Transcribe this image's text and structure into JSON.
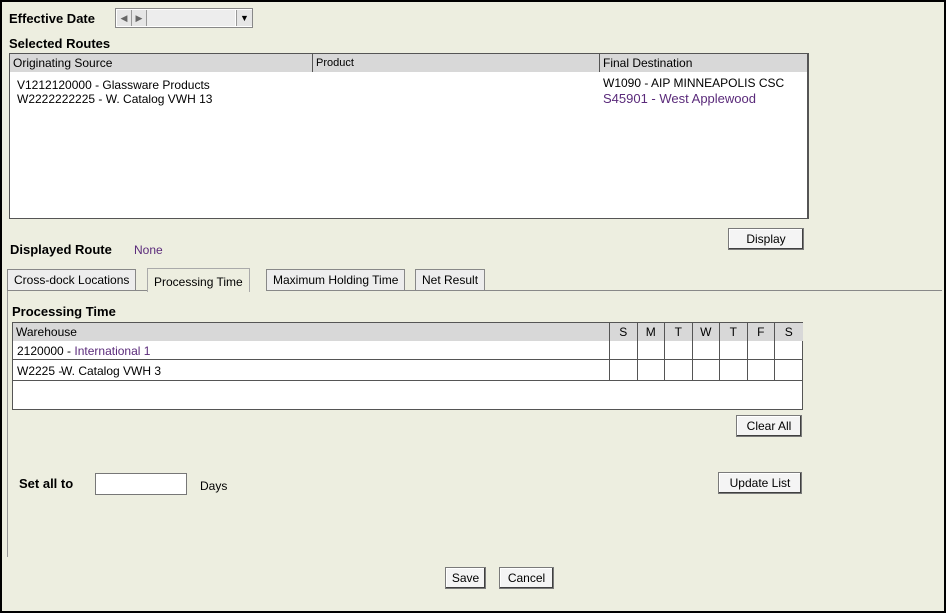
{
  "effective_date": {
    "label": "Effective Date",
    "value": ""
  },
  "selected_routes": {
    "title": "Selected Routes",
    "columns": {
      "originating_source": "Originating Source",
      "product": "Product",
      "final_destination": "Final Destination"
    },
    "rows": [
      {
        "source": "V1212120000 - Glassware Products",
        "destination_code": "W1090 - ",
        "destination_name": "AIP MINNEAPOLIS CSC"
      },
      {
        "source": "W2222222225 - W. Catalog VWH 13",
        "destination_code": "S45901 - ",
        "destination_name": "West Applewood"
      }
    ]
  },
  "displayed_route": {
    "label": "Displayed Route",
    "value": "None"
  },
  "display_button": "Display",
  "tabs": [
    {
      "label": "Cross-dock Locations",
      "active": false
    },
    {
      "label": "Processing Time",
      "active": true
    },
    {
      "label": "Maximum Holding Time",
      "active": false
    },
    {
      "label": "Net Result",
      "active": false
    }
  ],
  "processing_time": {
    "title": "Processing Time",
    "warehouse_header": "Warehouse",
    "days": [
      "S",
      "M",
      "T",
      "W",
      "T",
      "F",
      "S"
    ],
    "rows": [
      {
        "code": "2120000 - ",
        "name": "International 1"
      },
      {
        "code": "W2225 - ",
        "name": "W. Catalog VWH  3"
      }
    ]
  },
  "clear_all_button": "Clear All",
  "set_all": {
    "label": "Set all to",
    "value": "",
    "unit": "Days"
  },
  "update_list_button": "Update List",
  "save_button": "Save",
  "cancel_button": "Cancel"
}
